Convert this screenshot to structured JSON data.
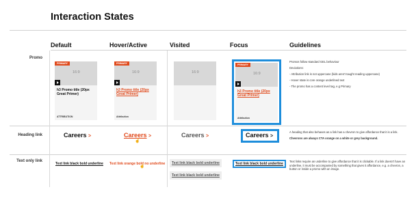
{
  "page": {
    "title": "Interaction States"
  },
  "columns": [
    "Default",
    "Hover/Active",
    "Visited",
    "Focus",
    "Guidelines"
  ],
  "rows": {
    "promo": "Promo",
    "heading_link": "Heading link",
    "text_only_link": "Text only link"
  },
  "promo_card": {
    "tag": "PRIMARY",
    "ratio": "16:9",
    "title_default": "h3 Promo title (20px Great Primer)",
    "title_hover": "h3 Promo title (20px Great Primer)",
    "attribution": "ATTRIBUTION",
    "attribution_alt": "Attribution"
  },
  "heading_link": {
    "text": "Careers",
    "chevron": ">"
  },
  "text_links": {
    "default": "Text link black bold underline",
    "hover": "Text link orange bold no underline",
    "visited": "Text link black bold underline",
    "visited_2": "Text link black bold underline",
    "focus": "Text link black bold underline"
  },
  "guidelines": {
    "promo": [
      "Promos follow standard GEL behaviour",
      "Deviations:",
      "- Attribution link is not uppercase (kids aren't taught reading uppercase)",
      "- Hover state is core orange underlined text",
      "- The promo has a content level tag, e.g Primary"
    ],
    "heading_link": [
      "A heading that also behaves as a link has a chevron to give affordance that it is a link.",
      "Chevrons are always CTA orange on a white or grey background."
    ],
    "text_only_link": [
      "Text links require an underline to give affordance that it is clickable. If a link doesn't have an underline, it must be accompanied by something that gives it affordance, e.g. a chevron, a button or inside a promo with an image."
    ]
  },
  "colors": {
    "accent_orange": "#e0491b",
    "focus_blue": "#1d8ddb",
    "visited_grey": "#555555"
  }
}
